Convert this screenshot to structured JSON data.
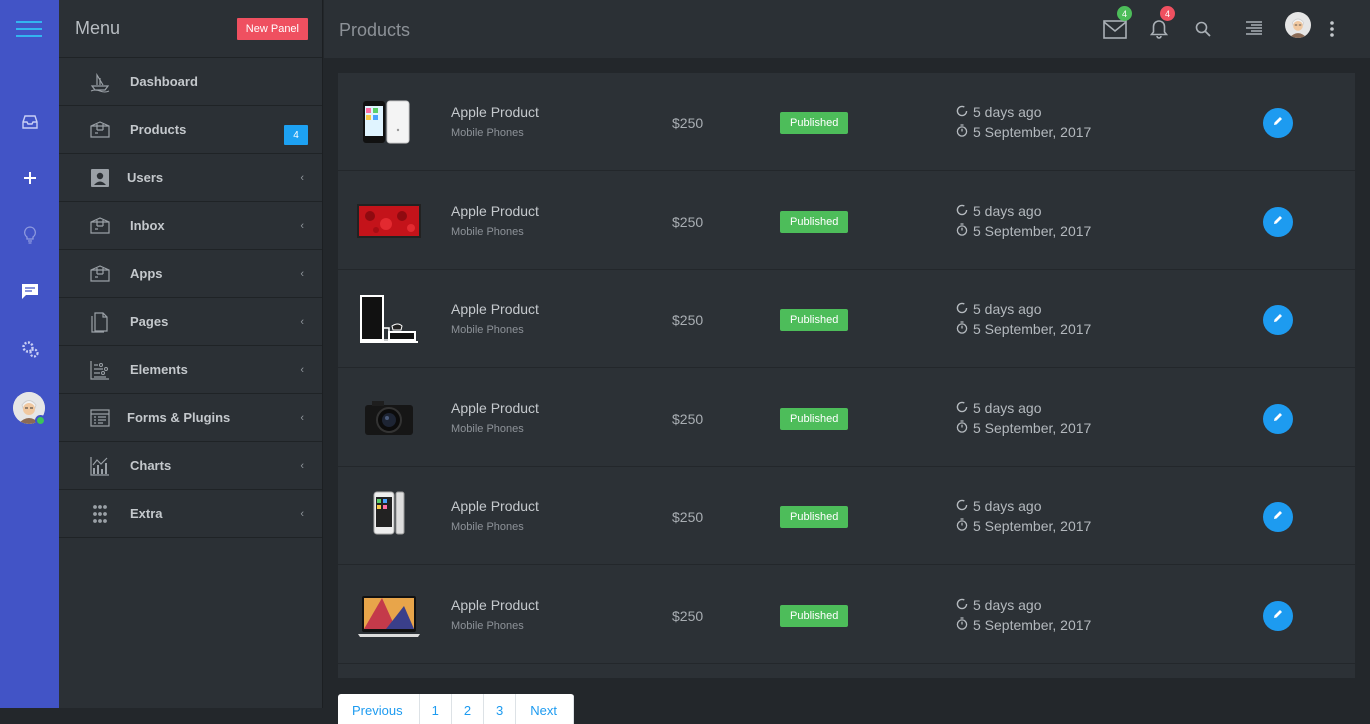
{
  "menu": {
    "title": "Menu",
    "new_panel": "New Panel",
    "items": [
      {
        "label": "Dashboard",
        "icon": "ship-icon",
        "chevron": false,
        "badge": ""
      },
      {
        "label": "Products",
        "icon": "box-icon",
        "chevron": false,
        "badge": "4"
      },
      {
        "label": "Users",
        "icon": "user-card-icon",
        "chevron": true,
        "badge": ""
      },
      {
        "label": "Inbox",
        "icon": "box-icon",
        "chevron": true,
        "badge": ""
      },
      {
        "label": "Apps",
        "icon": "box-icon",
        "chevron": true,
        "badge": ""
      },
      {
        "label": "Pages",
        "icon": "pages-icon",
        "chevron": true,
        "badge": ""
      },
      {
        "label": "Elements",
        "icon": "elements-icon",
        "chevron": true,
        "badge": ""
      },
      {
        "label": "Forms & Plugins",
        "icon": "form-icon",
        "chevron": true,
        "badge": ""
      },
      {
        "label": "Charts",
        "icon": "chart-icon",
        "chevron": true,
        "badge": ""
      },
      {
        "label": "Extra",
        "icon": "dots-grid-icon",
        "chevron": true,
        "badge": ""
      }
    ],
    "chevron_glyph": "‹"
  },
  "topbar": {
    "title": "Products",
    "mail_badge": "4",
    "bell_badge": "4"
  },
  "products": [
    {
      "name": "Apple Product",
      "category": "Mobile Phones",
      "price": "$250",
      "status": "Published",
      "relative": "5 days ago",
      "date": "5 September, 2017",
      "thumb": "iphone-5c"
    },
    {
      "name": "Apple Product",
      "category": "Mobile Phones",
      "price": "$250",
      "status": "Published",
      "relative": "5 days ago",
      "date": "5 September, 2017",
      "thumb": "red-tv"
    },
    {
      "name": "Apple Product",
      "category": "Mobile Phones",
      "price": "$250",
      "status": "Published",
      "relative": "5 days ago",
      "date": "5 September, 2017",
      "thumb": "console"
    },
    {
      "name": "Apple Product",
      "category": "Mobile Phones",
      "price": "$250",
      "status": "Published",
      "relative": "5 days ago",
      "date": "5 September, 2017",
      "thumb": "camera"
    },
    {
      "name": "Apple Product",
      "category": "Mobile Phones",
      "price": "$250",
      "status": "Published",
      "relative": "5 days ago",
      "date": "5 September, 2017",
      "thumb": "iphone-6"
    },
    {
      "name": "Apple Product",
      "category": "Mobile Phones",
      "price": "$250",
      "status": "Published",
      "relative": "5 days ago",
      "date": "5 September, 2017",
      "thumb": "laptop"
    }
  ],
  "pagination": {
    "previous": "Previous",
    "pages": [
      "1",
      "2",
      "3"
    ],
    "next": "Next"
  },
  "colors": {
    "rail": "#4254c6",
    "accent": "#1d9bf0",
    "published": "#4dbd5a",
    "new_panel": "#ef5060",
    "mail_badge": "#4dbd5a",
    "bell_badge": "#ef5060"
  }
}
